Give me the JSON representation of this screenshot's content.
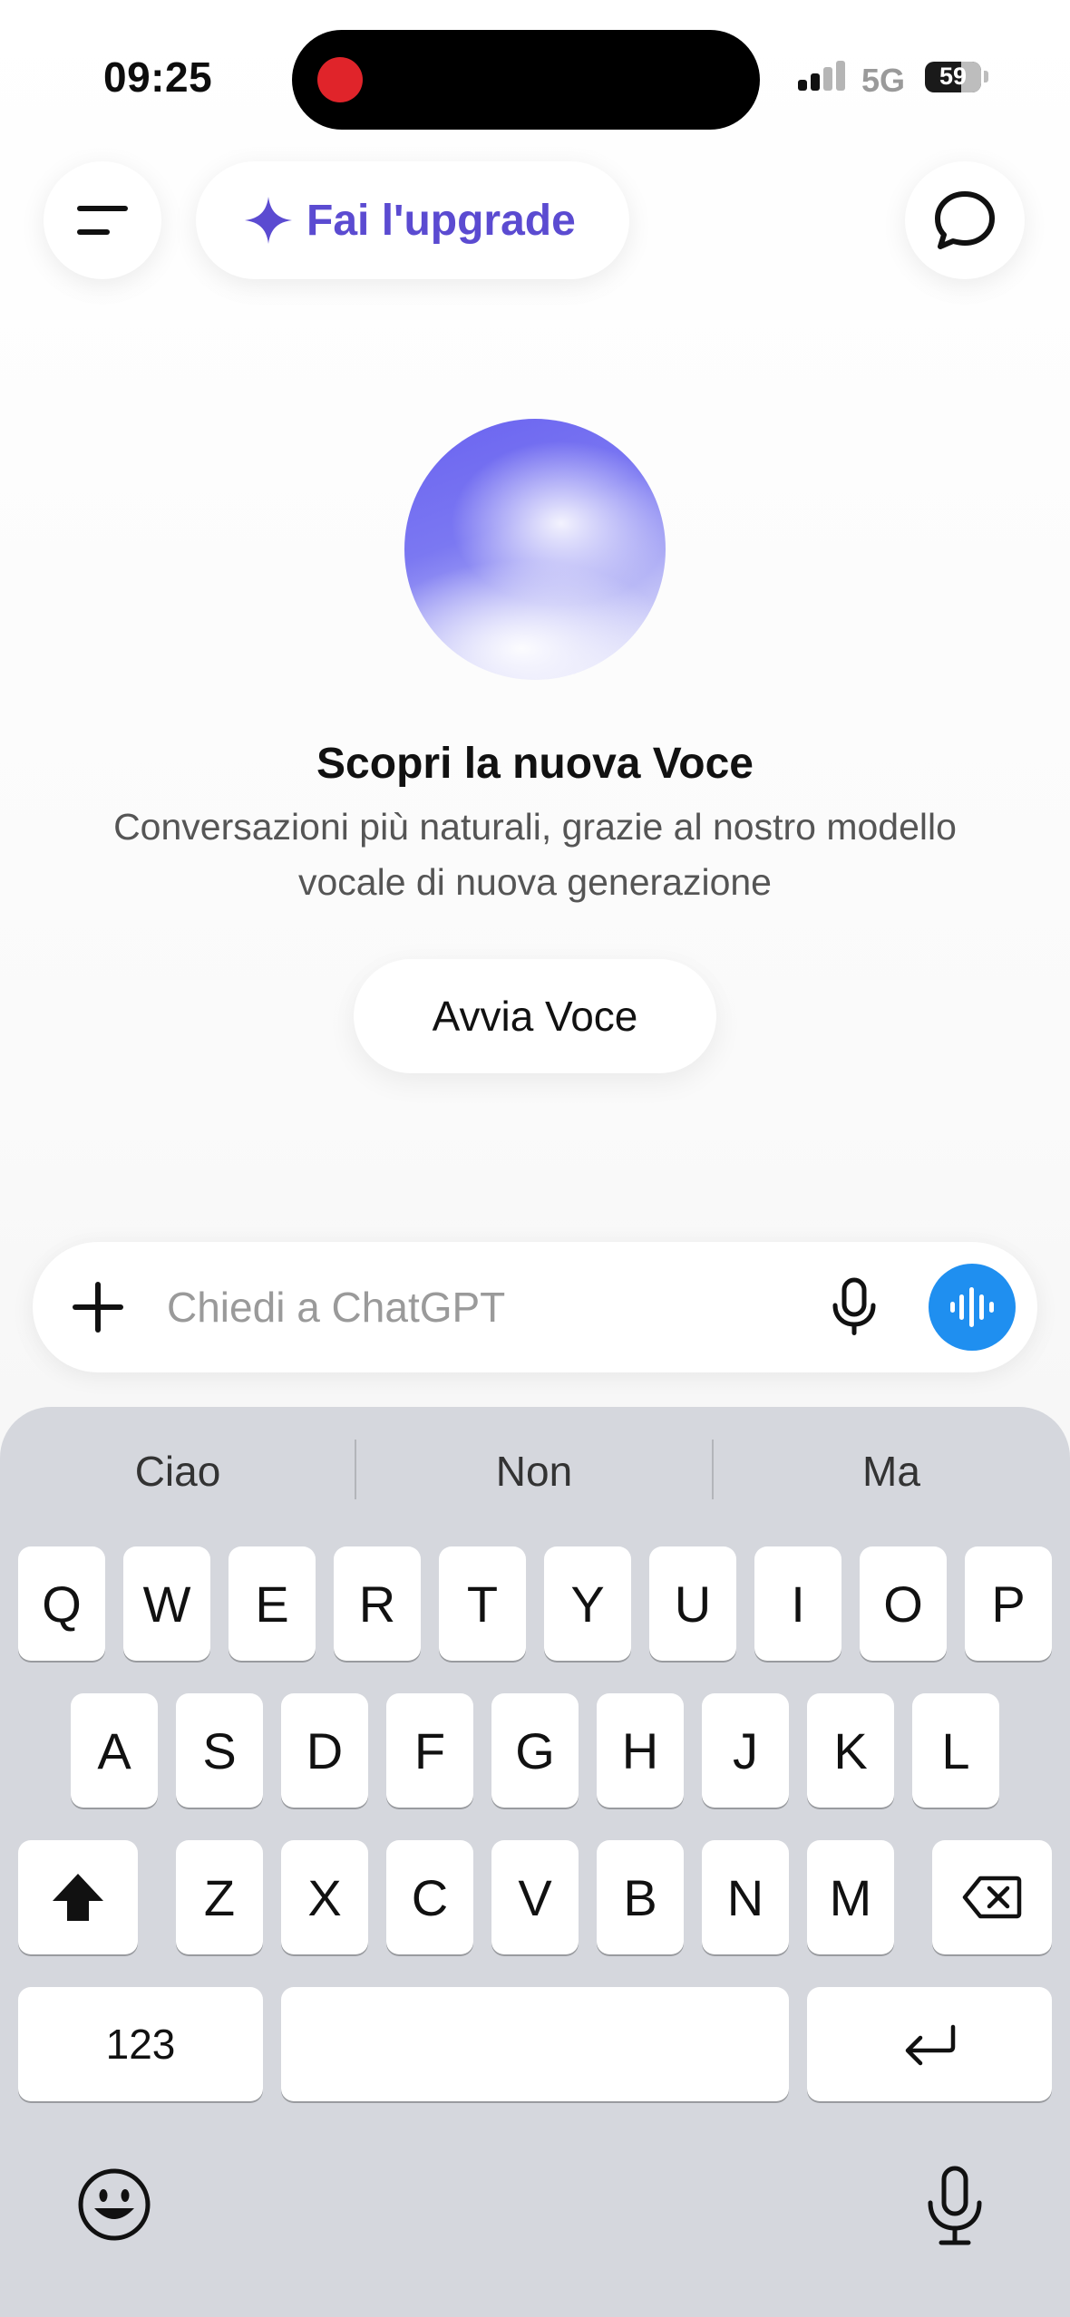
{
  "status_bar": {
    "time": "09:25",
    "network": "5G",
    "battery": "59"
  },
  "top_bar": {
    "upgrade_label": "Fai l'upgrade",
    "menu_icon": "hamburger-menu-icon",
    "new_chat_icon": "chat-bubble-icon",
    "accent_color": "#5b4bd1"
  },
  "voice_promo": {
    "title": "Scopri la nuova Voce",
    "description": "Conversazioni più naturali, grazie al nostro modello vocale di nuova generazione",
    "button_label": "Avvia Voce"
  },
  "composer": {
    "placeholder": "Chiedi a ChatGPT",
    "value": "",
    "voice_button_color": "#1f8ff0"
  },
  "keyboard": {
    "suggestions": [
      "Ciao",
      "Non",
      "Ma"
    ],
    "row1": [
      "Q",
      "W",
      "E",
      "R",
      "T",
      "Y",
      "U",
      "I",
      "O",
      "P"
    ],
    "row2": [
      "A",
      "S",
      "D",
      "F",
      "G",
      "H",
      "J",
      "K",
      "L"
    ],
    "row3": [
      "Z",
      "X",
      "C",
      "V",
      "B",
      "N",
      "M"
    ],
    "numbers_key": "123",
    "space_key": "",
    "return_icon": "return-icon",
    "emoji_icon": "emoji-icon",
    "dictation_icon": "microphone-icon"
  }
}
